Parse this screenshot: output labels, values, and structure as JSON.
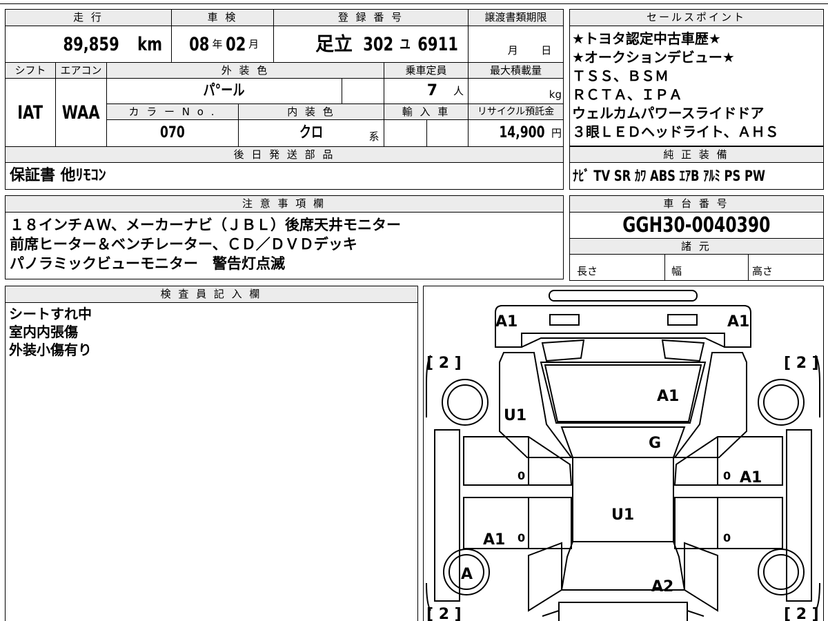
{
  "header": {
    "mileage_label": "走 行",
    "inspection_label": "車 検",
    "registration_label": "登 録 番 号",
    "transfer_deadline_label": "譲渡書類期限",
    "sales_points_label": "セールスポイント"
  },
  "vehicle": {
    "mileage": "89,859",
    "mileage_unit": "km",
    "inspection_year": "08",
    "inspection_year_unit": "年",
    "inspection_month": "02",
    "inspection_month_unit": "月",
    "plate_region": "足立",
    "plate_class": "302",
    "plate_kana": "ユ",
    "plate_number": "6911",
    "deadline_month_unit": "月",
    "deadline_day_unit": "日",
    "shift_label": "シフト",
    "shift": "IAT",
    "aircon_label": "エアコン",
    "aircon": "WAA",
    "exterior_color_label": "外 装 色",
    "exterior_color": "パ°ール",
    "color_no_label": "カ ラ ー N o .",
    "color_no": "070",
    "interior_color_label": "内 装 色",
    "interior_color": "クロ",
    "interior_suffix": "系",
    "capacity_label": "乗車定員",
    "capacity": "7",
    "capacity_unit": "人",
    "max_load_label": "最大積載量",
    "max_load_unit": "kg",
    "import_label": "輸 入 車",
    "recycle_label": "リサイクル預託金",
    "recycle_fee": "14,900",
    "recycle_unit": "円"
  },
  "sales_points": {
    "lines": [
      "★トヨタ認定中古車歴★",
      "★オークションデビュー★",
      "ＴＳＳ、ＢＳＭ",
      "ＲＣＴＡ、ＩＰＡ",
      "ウェルカムパワースライドドア",
      "３眼ＬＥＤヘッドライト、ＡＨＳ"
    ]
  },
  "later_parts": {
    "label": "後 日 発 送 部 品",
    "value": "保証書 他ﾘﾓｺﾝ"
  },
  "equipment": {
    "label": "純 正 装 備",
    "value": "ﾅﾋﾞ TV SR ｶﾜ ABS ｴｱB ｱﾙﾐ PS PW"
  },
  "notes": {
    "label": "注 意 事 項 欄",
    "lines": [
      "１８インチＡＷ、メーカーナビ（ＪＢＬ）後席天井モニター",
      "前席ヒーター＆ベンチレーター、ＣＤ／ＤＶＤデッキ",
      "パノラミックビューモニター　警告灯点滅"
    ]
  },
  "chassis": {
    "label": "車 台 番 号",
    "value": "GGH30-0040390",
    "specs_label": "諸 元",
    "length_label": "長さ",
    "width_label": "幅",
    "height_label": "高さ"
  },
  "inspector": {
    "label": "検 査 員 記 入 欄",
    "lines": [
      "シートすれ中",
      "室内内張傷",
      "外装小傷有り"
    ]
  },
  "diagram": {
    "marks": {
      "front_left": "A1",
      "front_right": "A1",
      "bonnet": "A1",
      "front_left_fender": "U1",
      "windshield": "G",
      "right_front_door": "A1",
      "roof": "U1",
      "left_rear_door": "A1",
      "left_rear_wheel": "A",
      "rear_glass": "A2",
      "front_left_tire": "[ 2 ]",
      "front_right_tire": "[ 2 ]",
      "rear_left_tire": "[ 2 ]",
      "rear_right_tire": "[ 2 ]",
      "door_zero_1": "0",
      "door_zero_2": "0",
      "door_zero_3": "0",
      "door_zero_4": "0"
    }
  }
}
